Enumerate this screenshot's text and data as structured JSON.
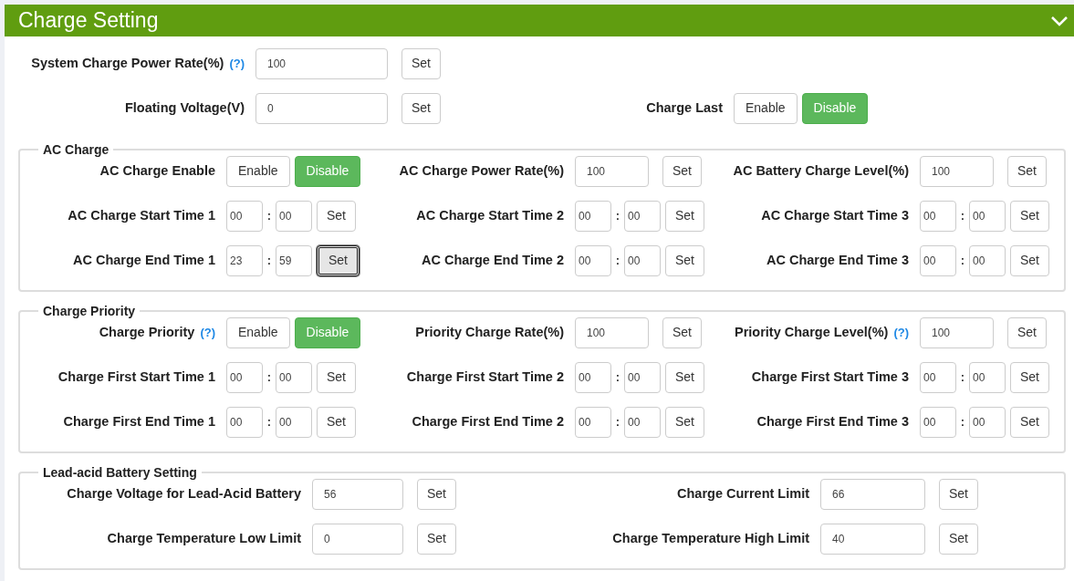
{
  "header": {
    "title": "Charge Setting"
  },
  "general": {
    "rows": [
      [
        {
          "kind": "number",
          "label": "System Charge Power Rate(%)",
          "help": "(?)",
          "value": "100",
          "button": "Set",
          "button_focused": false
        }
      ],
      [
        {
          "kind": "number",
          "label": "Floating Voltage(V)",
          "value": "0",
          "button": "Set",
          "button_focused": false
        },
        {
          "kind": "toggle",
          "label": "Charge Last",
          "options": [
            {
              "label": "Enable",
              "selected": false
            },
            {
              "label": "Disable",
              "selected": true
            }
          ]
        }
      ]
    ]
  },
  "sections": [
    {
      "legend": "AC Charge",
      "rows": [
        [
          {
            "kind": "toggle",
            "label": "AC Charge Enable",
            "options": [
              {
                "label": "Enable",
                "selected": false
              },
              {
                "label": "Disable",
                "selected": true
              }
            ]
          },
          {
            "kind": "number",
            "label": "AC Charge Power Rate(%)",
            "value": "100",
            "button": "Set",
            "button_focused": false
          },
          {
            "kind": "number",
            "label": "AC Battery Charge Level(%)",
            "value": "100",
            "button": "Set",
            "button_focused": false
          }
        ],
        [
          {
            "kind": "time",
            "label": "AC Charge Start Time 1",
            "hour": "00",
            "separator": ":",
            "minute": "00",
            "button": "Set",
            "button_focused": false
          },
          {
            "kind": "time",
            "label": "AC Charge Start Time 2",
            "hour": "00",
            "separator": ":",
            "minute": "00",
            "button": "Set",
            "button_focused": false
          },
          {
            "kind": "time",
            "label": "AC Charge Start Time 3",
            "hour": "00",
            "separator": ":",
            "minute": "00",
            "button": "Set",
            "button_focused": false
          }
        ],
        [
          {
            "kind": "time",
            "label": "AC Charge End Time 1",
            "hour": "23",
            "separator": ":",
            "minute": "59",
            "button": "Set",
            "button_focused": true
          },
          {
            "kind": "time",
            "label": "AC Charge End Time 2",
            "hour": "00",
            "separator": ":",
            "minute": "00",
            "button": "Set",
            "button_focused": false
          },
          {
            "kind": "time",
            "label": "AC Charge End Time 3",
            "hour": "00",
            "separator": ":",
            "minute": "00",
            "button": "Set",
            "button_focused": false
          }
        ]
      ]
    },
    {
      "legend": "Charge Priority",
      "rows": [
        [
          {
            "kind": "toggle",
            "label": "Charge Priority",
            "help": "(?)",
            "options": [
              {
                "label": "Enable",
                "selected": false
              },
              {
                "label": "Disable",
                "selected": true
              }
            ]
          },
          {
            "kind": "number",
            "label": "Priority Charge Rate(%)",
            "value": "100",
            "button": "Set",
            "button_focused": false
          },
          {
            "kind": "number",
            "label": "Priority Charge Level(%)",
            "help": "(?)",
            "value": "100",
            "button": "Set",
            "button_focused": false
          }
        ],
        [
          {
            "kind": "time",
            "label": "Charge First Start Time 1",
            "hour": "00",
            "separator": ":",
            "minute": "00",
            "button": "Set",
            "button_focused": false
          },
          {
            "kind": "time",
            "label": "Charge First Start Time 2",
            "hour": "00",
            "separator": ":",
            "minute": "00",
            "button": "Set",
            "button_focused": false
          },
          {
            "kind": "time",
            "label": "Charge First Start Time 3",
            "hour": "00",
            "separator": ":",
            "minute": "00",
            "button": "Set",
            "button_focused": false
          }
        ],
        [
          {
            "kind": "time",
            "label": "Charge First End Time 1",
            "hour": "00",
            "separator": ":",
            "minute": "00",
            "button": "Set",
            "button_focused": false
          },
          {
            "kind": "time",
            "label": "Charge First End Time 2",
            "hour": "00",
            "separator": ":",
            "minute": "00",
            "button": "Set",
            "button_focused": false
          },
          {
            "kind": "time",
            "label": "Charge First End Time 3",
            "hour": "00",
            "separator": ":",
            "minute": "00",
            "button": "Set",
            "button_focused": false
          }
        ]
      ]
    },
    {
      "legend": "Lead-acid Battery Setting",
      "rows": [
        [
          {
            "kind": "number",
            "label": "Charge Voltage for Lead-Acid Battery",
            "value": "56",
            "button": "Set",
            "button_focused": false
          },
          {
            "kind": "number",
            "label": "Charge Current Limit",
            "value": "66",
            "button": "Set",
            "button_focused": false
          }
        ],
        [
          {
            "kind": "number",
            "label": "Charge Temperature Low Limit",
            "value": "0",
            "button": "Set",
            "button_focused": false
          },
          {
            "kind": "number",
            "label": "Charge Temperature High Limit",
            "value": "40",
            "button": "Set",
            "button_focused": false
          }
        ]
      ]
    }
  ]
}
